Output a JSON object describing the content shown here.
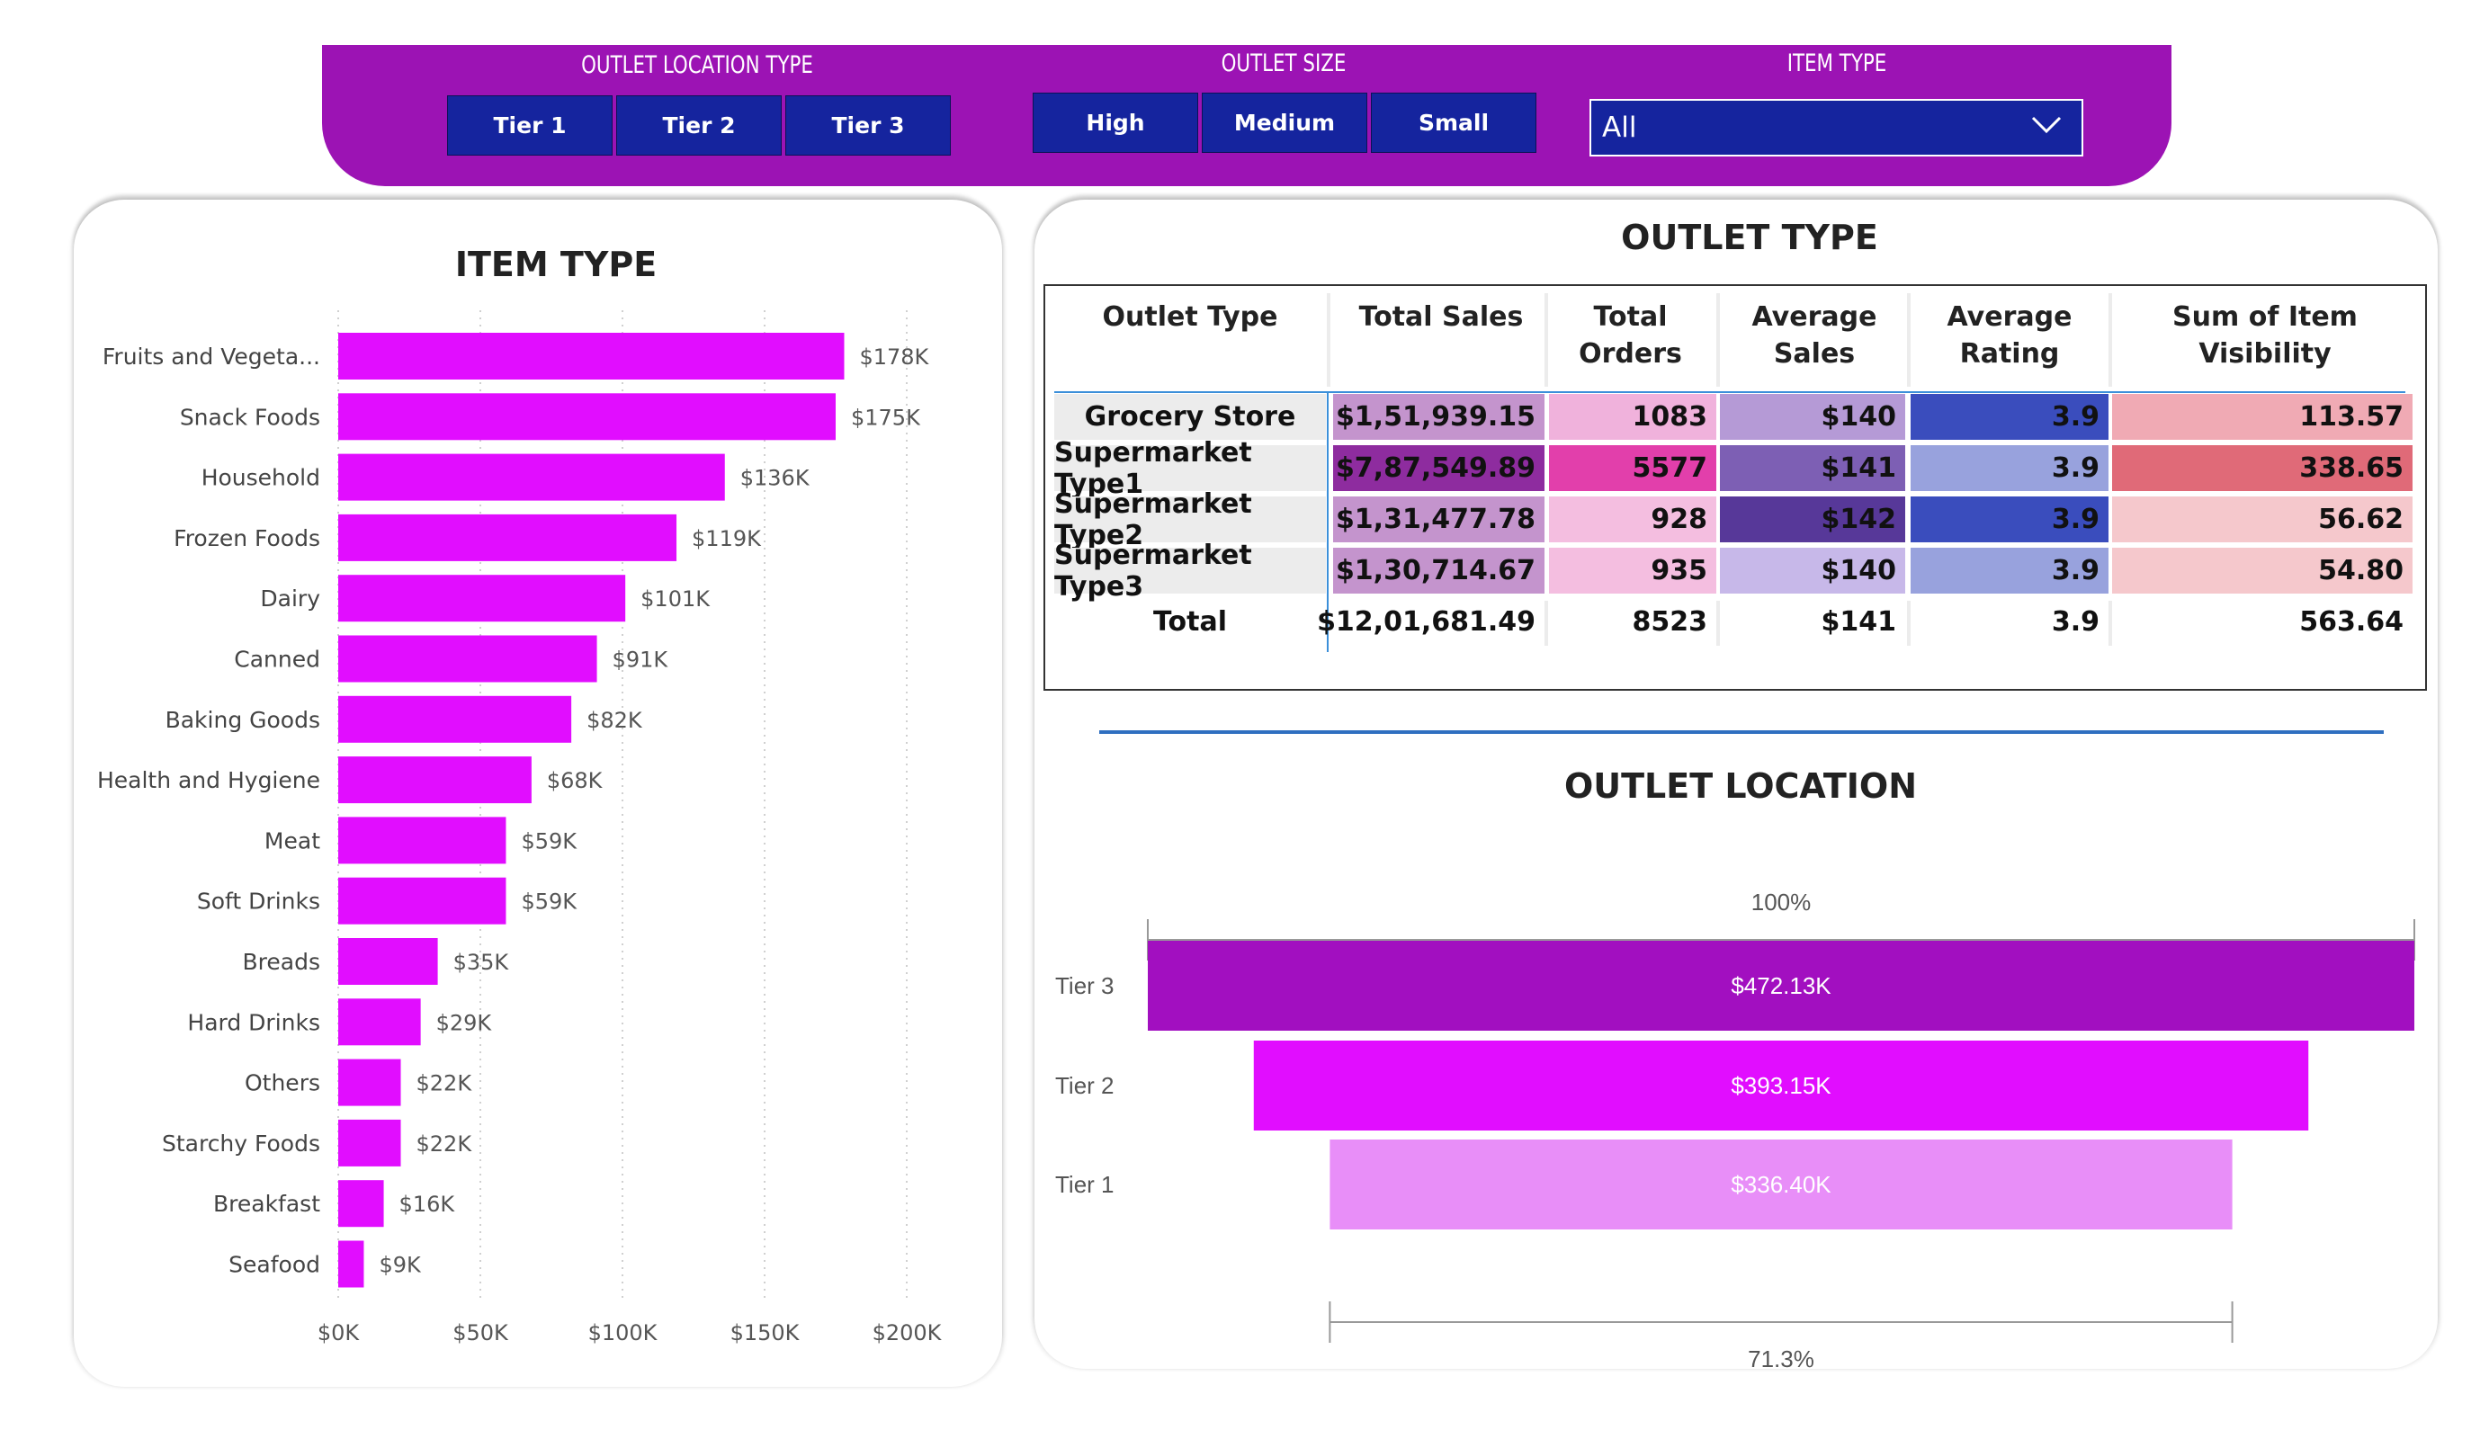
{
  "filters": {
    "outlet_location_type": {
      "title": "OUTLET LOCATION TYPE",
      "options": [
        "Tier 1",
        "Tier 2",
        "Tier 3"
      ]
    },
    "outlet_size": {
      "title": "OUTLET SIZE",
      "options": [
        "High",
        "Medium",
        "Small"
      ]
    },
    "item_type": {
      "title": "ITEM TYPE",
      "selected": "All"
    }
  },
  "colors": {
    "filter_bar": "#9c13b4",
    "slicer_button": "#15249e",
    "bar": "#e10dff",
    "funnel_tier3": "#a20fc0",
    "funnel_tier2": "#e10dff",
    "funnel_tier1": "#e88ef8"
  },
  "item_type_chart": {
    "title": "ITEM TYPE",
    "chart_data": {
      "type": "bar",
      "orientation": "horizontal",
      "title": "ITEM TYPE",
      "categories": [
        "Fruits and Vegeta...",
        "Snack Foods",
        "Household",
        "Frozen Foods",
        "Dairy",
        "Canned",
        "Baking Goods",
        "Health and Hygiene",
        "Meat",
        "Soft Drinks",
        "Breads",
        "Hard Drinks",
        "Others",
        "Starchy Foods",
        "Breakfast",
        "Seafood"
      ],
      "values": [
        178,
        175,
        136,
        119,
        101,
        91,
        82,
        68,
        59,
        59,
        35,
        29,
        22,
        22,
        16,
        9
      ],
      "data_labels": [
        "$178K",
        "$175K",
        "$136K",
        "$119K",
        "$101K",
        "$91K",
        "$82K",
        "$68K",
        "$59K",
        "$59K",
        "$35K",
        "$29K",
        "$22K",
        "$22K",
        "$16K",
        "$9K"
      ],
      "x_ticks": [
        0,
        50,
        100,
        150,
        200
      ],
      "x_tick_labels": [
        "$0K",
        "$50K",
        "$100K",
        "$150K",
        "$200K"
      ],
      "xlim": [
        0,
        200
      ],
      "grid": "vertical dotted"
    }
  },
  "outlet_type_table": {
    "title": "OUTLET TYPE",
    "headers": [
      "Outlet Type",
      "Total Sales",
      "Total\nOrders",
      "Average\nSales",
      "Average\nRating",
      "Sum of Item Visibility"
    ],
    "rows": [
      {
        "name": "Grocery Store",
        "total_sales": "$1,51,939.15",
        "total_orders": "1083",
        "avg_sales": "$140",
        "avg_rating": "3.9",
        "visibility": "113.57"
      },
      {
        "name": "Supermarket Type1",
        "total_sales": "$7,87,549.89",
        "total_orders": "5577",
        "avg_sales": "$141",
        "avg_rating": "3.9",
        "visibility": "338.65"
      },
      {
        "name": "Supermarket Type2",
        "total_sales": "$1,31,477.78",
        "total_orders": "928",
        "avg_sales": "$142",
        "avg_rating": "3.9",
        "visibility": "56.62"
      },
      {
        "name": "Supermarket Type3",
        "total_sales": "$1,30,714.67",
        "total_orders": "935",
        "avg_sales": "$140",
        "avg_rating": "3.9",
        "visibility": "54.80"
      }
    ],
    "total": {
      "name": "Total",
      "total_sales": "$12,01,681.49",
      "total_orders": "8523",
      "avg_sales": "$141",
      "avg_rating": "3.9",
      "visibility": "563.64"
    },
    "cell_colors": [
      [
        "#c494cd",
        "#f0b2dc",
        "#b59ad6",
        "#3a4dbd",
        "#f0aab4"
      ],
      [
        "#8e2c9f",
        "#e23fab",
        "#7d5fb4",
        "#98a2dd",
        "#e06a78"
      ],
      [
        "#c494cd",
        "#f4bee0",
        "#573899",
        "#3a4dbd",
        "#f5c8cc"
      ],
      [
        "#c494cd",
        "#f4bee0",
        "#c7b8e9",
        "#98a2dd",
        "#f5c8cc"
      ]
    ]
  },
  "outlet_location_funnel": {
    "title": "OUTLET LOCATION",
    "top_label": "100%",
    "bottom_label": "71.3%",
    "chart_data": {
      "type": "funnel",
      "title": "OUTLET LOCATION",
      "categories": [
        "Tier 3",
        "Tier 2",
        "Tier 1"
      ],
      "values": [
        472.13,
        393.15,
        336.4
      ],
      "data_labels": [
        "$472.13K",
        "$393.15K",
        "$336.40K"
      ],
      "conversion_top": "100%",
      "conversion_bottom": "71.3%"
    }
  }
}
